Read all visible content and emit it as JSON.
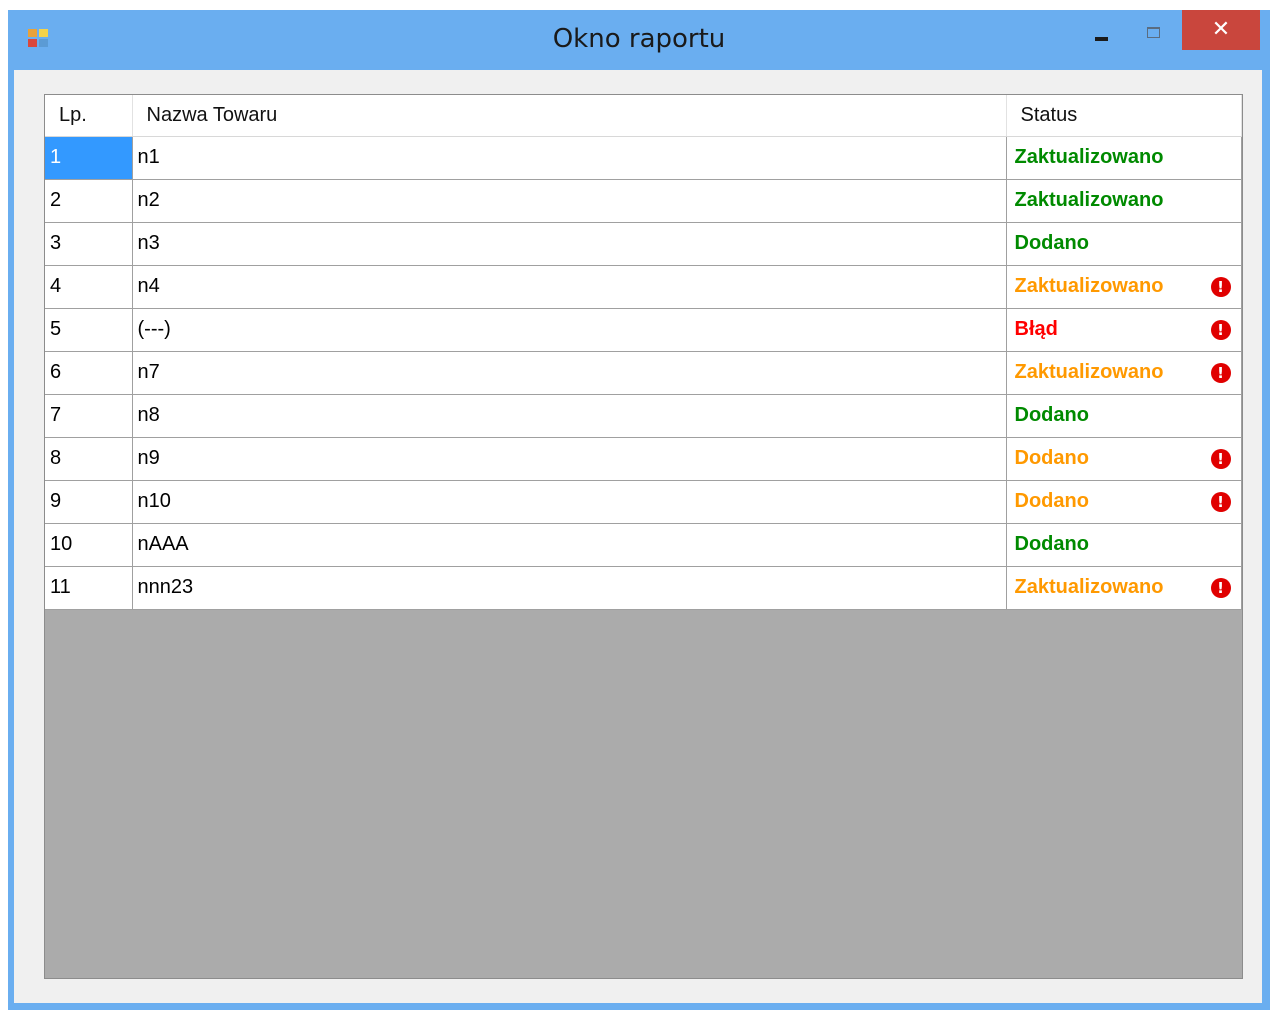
{
  "window": {
    "title": "Okno raportu",
    "controls": {
      "minimize": "minimize",
      "maximize": "maximize",
      "close": "✕"
    }
  },
  "colors": {
    "titlebar": "#6aaef0",
    "close_button": "#c9463d",
    "selection": "#3399ff",
    "status_ok": "#008a00",
    "status_warning": "#ff9900",
    "status_error": "#ff0000"
  },
  "table": {
    "columns": [
      "Lp.",
      "Nazwa Towaru",
      "Status"
    ],
    "rows": [
      {
        "lp": "1",
        "name": "n1",
        "status": "Zaktualizowano",
        "level": "ok",
        "warning": false,
        "selected": true
      },
      {
        "lp": "2",
        "name": "n2",
        "status": "Zaktualizowano",
        "level": "ok",
        "warning": false,
        "selected": false
      },
      {
        "lp": "3",
        "name": "n3",
        "status": "Dodano",
        "level": "ok",
        "warning": false,
        "selected": false
      },
      {
        "lp": "4",
        "name": "n4",
        "status": "Zaktualizowano",
        "level": "warning",
        "warning": true,
        "selected": false
      },
      {
        "lp": "5",
        "name": "(---)",
        "status": "Błąd",
        "level": "error",
        "warning": true,
        "selected": false
      },
      {
        "lp": "6",
        "name": "n7",
        "status": "Zaktualizowano",
        "level": "warning",
        "warning": true,
        "selected": false
      },
      {
        "lp": "7",
        "name": "n8",
        "status": "Dodano",
        "level": "ok",
        "warning": false,
        "selected": false
      },
      {
        "lp": "8",
        "name": "n9",
        "status": "Dodano",
        "level": "warning",
        "warning": true,
        "selected": false
      },
      {
        "lp": "9",
        "name": "n10",
        "status": "Dodano",
        "level": "warning",
        "warning": true,
        "selected": false
      },
      {
        "lp": "10",
        "name": "nAAA",
        "status": "Dodano",
        "level": "ok",
        "warning": false,
        "selected": false
      },
      {
        "lp": "11",
        "name": "nnn23",
        "status": "Zaktualizowano",
        "level": "warning",
        "warning": true,
        "selected": false
      }
    ],
    "warning_icon": "exclamation-circle-icon"
  }
}
